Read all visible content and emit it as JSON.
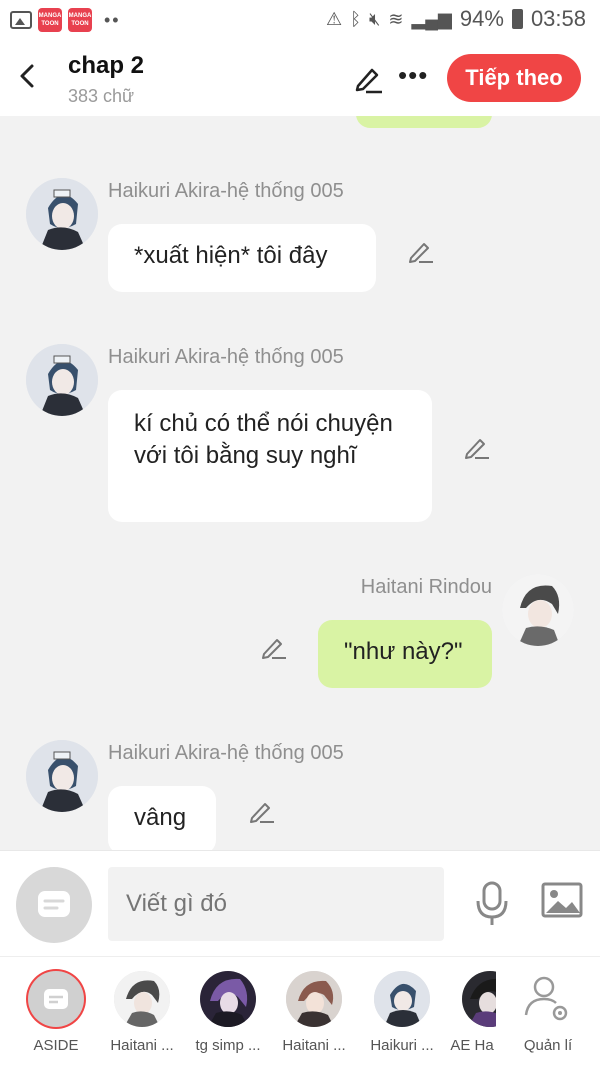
{
  "status_bar": {
    "app_icon_text": "MANGA TOON",
    "battery": "94%",
    "time": "03:58"
  },
  "header": {
    "title": "chap 2",
    "word_count": "383 chữ",
    "next_button": "Tiếp theo"
  },
  "messages": [
    {
      "sender": "Haikuri Akira-hệ thống 005",
      "text": "*xuất hiện* tôi đây",
      "side": "left"
    },
    {
      "sender": "Haikuri Akira-hệ thống 005",
      "text": "kí chủ có thể nói chuyện với tôi bằng suy nghĩ",
      "side": "left"
    },
    {
      "sender": "Haitani Rindou",
      "text": "\"như này?\"",
      "side": "right"
    },
    {
      "sender": "Haikuri Akira-hệ thống 005",
      "text": "vâng",
      "side": "left"
    }
  ],
  "composer": {
    "placeholder": "Viết gì đó"
  },
  "characters": [
    {
      "label": "ASIDE"
    },
    {
      "label": "Haitani ..."
    },
    {
      "label": "tg simp ..."
    },
    {
      "label": "Haitani ..."
    },
    {
      "label": "Haikuri ..."
    },
    {
      "label": "AE Ha"
    },
    {
      "label": "Quản lí"
    }
  ],
  "colors": {
    "accent": "#f04545",
    "my_bubble": "#d9f3a4"
  }
}
